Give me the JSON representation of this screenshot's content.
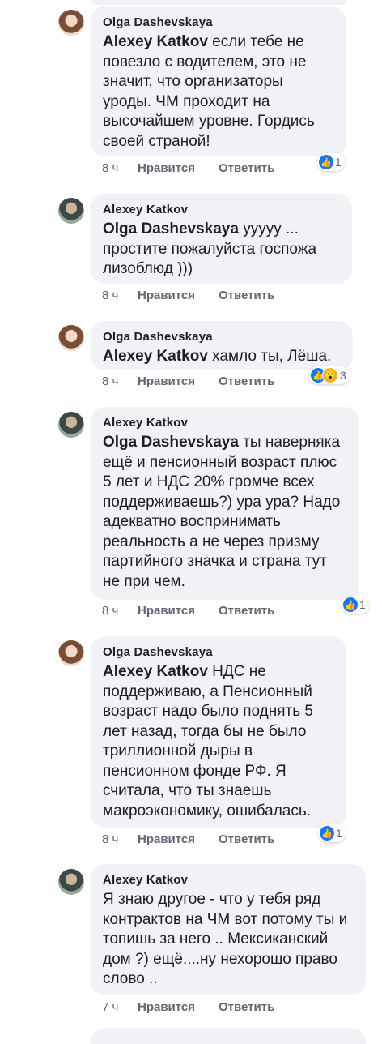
{
  "comments": [
    {
      "author": "Olga Dashevskaya",
      "mention": "Alexey Katkov",
      "text": " если тебе не повезло с водителем, это не значит, что организаторы уроды. ЧМ проходит на высочайшем уровне. Гордись своей страной!",
      "time": "8 ч",
      "like_label": "Нравится",
      "reply_label": "Ответить",
      "reactions": {
        "icons": [
          "like-icon"
        ],
        "count": "1"
      }
    },
    {
      "author": "Alexey Katkov",
      "mention": "Olga Dashevskaya",
      "text": " ууууу ... простите пожалуйста госпожа лизоблюд )))",
      "time": "8 ч",
      "like_label": "Нравится",
      "reply_label": "Ответить",
      "reactions": null
    },
    {
      "author": "Olga Dashevskaya",
      "mention": "Alexey Katkov",
      "text": " хамло ты, Лёша.",
      "time": "8 ч",
      "like_label": "Нравится",
      "reply_label": "Ответить",
      "reactions": {
        "icons": [
          "like-icon",
          "wow-icon"
        ],
        "count": "3"
      }
    },
    {
      "author": "Alexey Katkov",
      "mention": "Olga Dashevskaya",
      "text": " ты наверняка ещё и пенсионный возраст плюс 5 лет и НДС 20% громче всех поддерживаешь?) ура ура? Надо адекватно воспринимать реальность а не через призму партийного значка и страна тут не при чем.",
      "time": "8 ч",
      "like_label": "Нравится",
      "reply_label": "Ответить",
      "reactions": {
        "icons": [
          "like-icon"
        ],
        "count": "1"
      }
    },
    {
      "author": "Olga Dashevskaya",
      "mention": "Alexey Katkov",
      "text": " НДС не поддерживаю, а Пенсионный возраст надо было поднять 5 лет назад, тогда бы не было триллионной дыры в пенсионном фонде РФ. Я считала, что ты знаешь макроэкономику, ошибалась.",
      "time": "8 ч",
      "like_label": "Нравится",
      "reply_label": "Ответить",
      "reactions": {
        "icons": [
          "like-icon"
        ],
        "count": "1"
      }
    },
    {
      "author": "Alexey Katkov",
      "mention": "",
      "text": "Я знаю другое - что у тебя ряд контрактов на ЧМ вот потому ты и топишь за него .. Мексиканский дом ?) ещё....ну нехорошо право слово ..",
      "time": "7 ч",
      "like_label": "Нравится",
      "reply_label": "Ответить",
      "reactions": null
    }
  ]
}
